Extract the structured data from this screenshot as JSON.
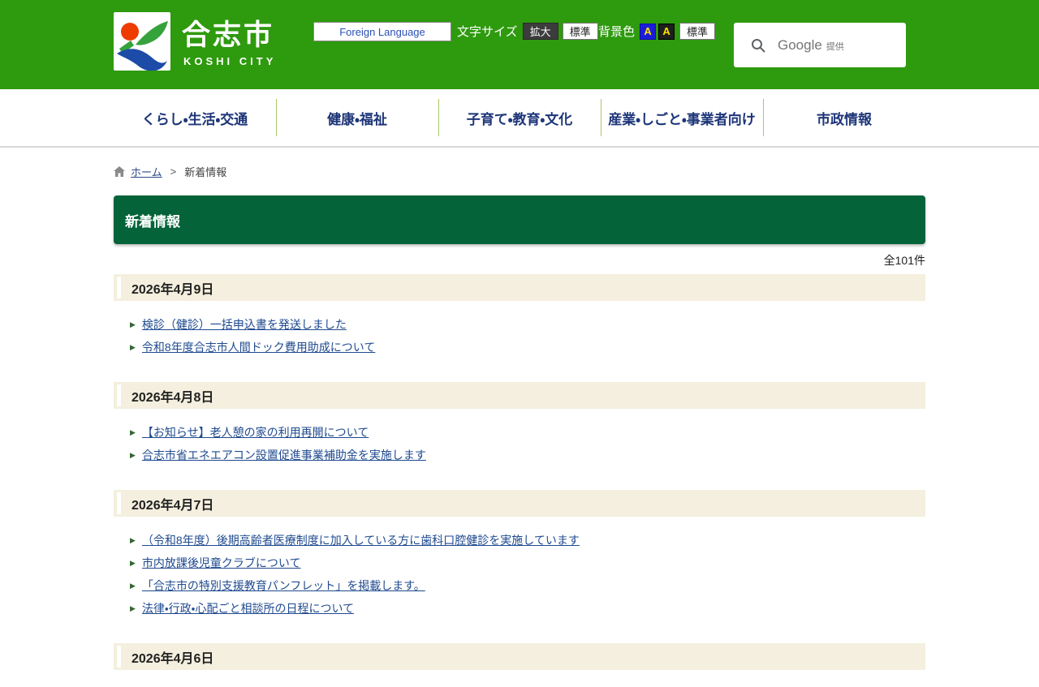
{
  "header": {
    "city_name": "合志市",
    "city_name_en": "KOSHI CITY",
    "foreign_language_label": "Foreign Language",
    "font_size": {
      "label": "文字サイズ",
      "enlarge": "拡大",
      "standard": "標準"
    },
    "bg_color": {
      "label": "背景色",
      "blue_option": "A",
      "black_option": "A",
      "standard": "標準"
    },
    "search": {
      "brand": "Google",
      "suffix": "提供"
    }
  },
  "nav": {
    "items": [
      {
        "label": "くらし・生活・交通"
      },
      {
        "label": "健康・福祉"
      },
      {
        "label": "子育て・教育・文化"
      },
      {
        "label": "産業・しごと・事業者向け"
      },
      {
        "label": "市政情報"
      }
    ]
  },
  "breadcrumb": {
    "home": "ホーム",
    "separator": ">",
    "current": "新着情報"
  },
  "page": {
    "title": "新着情報",
    "total_count": "全101件"
  },
  "news": {
    "sections": [
      {
        "date": "2026年4月9日",
        "items": [
          "検診（健診）一括申込書を発送しました",
          "令和8年度合志市人間ドック費用助成について"
        ]
      },
      {
        "date": "2026年4月8日",
        "items": [
          "【お知らせ】老人憩の家の利用再開について",
          "合志市省エネエアコン設置促進事業補助金を実施します"
        ]
      },
      {
        "date": "2026年4月7日",
        "items": [
          "（令和8年度）後期高齢者医療制度に加入している方に歯科口腔健診を実施しています",
          "市内放課後児童クラブについて",
          "「合志市の特別支援教育パンフレット」を掲載します。",
          "法律・行政・心配ごと相談所の日程について"
        ]
      },
      {
        "date": "2026年4月6日",
        "items": []
      }
    ]
  },
  "colors": {
    "header_green": "#2e9a0e",
    "title_banner_green": "#046338",
    "date_bar_beige": "#f4efde",
    "link_blue": "#1f4a8f",
    "nav_text_blue": "#1d3578",
    "nav_separator_green": "#a9c967",
    "enlarge_button_bg": "#3c3c3c",
    "bg_option_blue": "#1c1cd8",
    "bg_option_black": "#1e1e1e",
    "bg_option_letter_yellow": "#ffe400"
  }
}
